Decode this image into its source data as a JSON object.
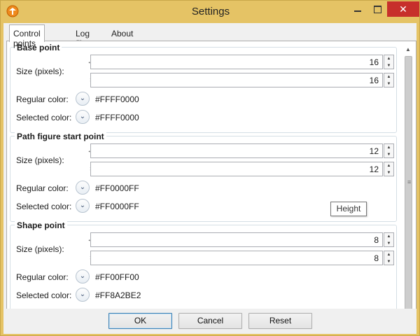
{
  "window": {
    "title": "Settings",
    "accent_color": "#E5C365",
    "close_color": "#C7302B",
    "close_glyph": "✕",
    "min_glyph": "",
    "max_glyph": ""
  },
  "tabs": [
    {
      "label": "Control points",
      "active": true
    },
    {
      "label": "Log file",
      "active": false
    },
    {
      "label": "About",
      "active": false
    }
  ],
  "groups": [
    {
      "title": "Base point",
      "size_label": "Size (pixels):",
      "width_value": "16",
      "height_value": "16",
      "regular_label": "Regular color:",
      "regular_value": "#FFFF0000",
      "selected_label": "Selected color:",
      "selected_value": "#FFFF0000"
    },
    {
      "title": "Path figure start point",
      "size_label": "Size (pixels):",
      "width_value": "12",
      "height_value": "12",
      "regular_label": "Regular color:",
      "regular_value": "#FF0000FF",
      "selected_label": "Selected color:",
      "selected_value": "#FF0000FF"
    },
    {
      "title": "Shape point",
      "size_label": "Size (pixels):",
      "width_value": "8",
      "height_value": "8",
      "regular_label": "Regular color:",
      "regular_value": "#FF00FF00",
      "selected_label": "Selected color:",
      "selected_value": "#FF8A2BE2"
    }
  ],
  "tooltip": "Height",
  "buttons": {
    "ok": "OK",
    "cancel": "Cancel",
    "reset": "Reset"
  },
  "icons": {
    "width": "width-arrows-icon",
    "height": "height-arrows-icon",
    "dropdown": "chevron-down-icon",
    "spin_up": "▲",
    "spin_down": "▼",
    "width_glyph": "↔",
    "height_glyph": "↕",
    "chevron_glyph": "⌄"
  }
}
